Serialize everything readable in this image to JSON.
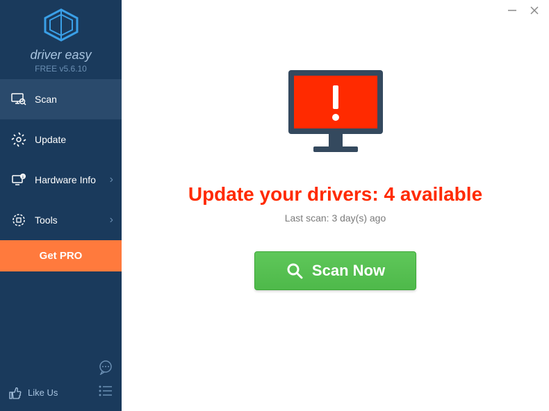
{
  "app": {
    "name": "driver easy",
    "version_line": "FREE v5.6.10"
  },
  "sidebar": {
    "items": [
      {
        "label": "Scan",
        "has_chevron": false
      },
      {
        "label": "Update",
        "has_chevron": false
      },
      {
        "label": "Hardware Info",
        "has_chevron": true
      },
      {
        "label": "Tools",
        "has_chevron": true
      }
    ],
    "get_pro_label": "Get PRO",
    "like_us_label": "Like Us"
  },
  "main": {
    "headline": "Update your drivers: 4 available",
    "last_scan": "Last scan: 3 day(s) ago",
    "scan_button_label": "Scan Now"
  }
}
